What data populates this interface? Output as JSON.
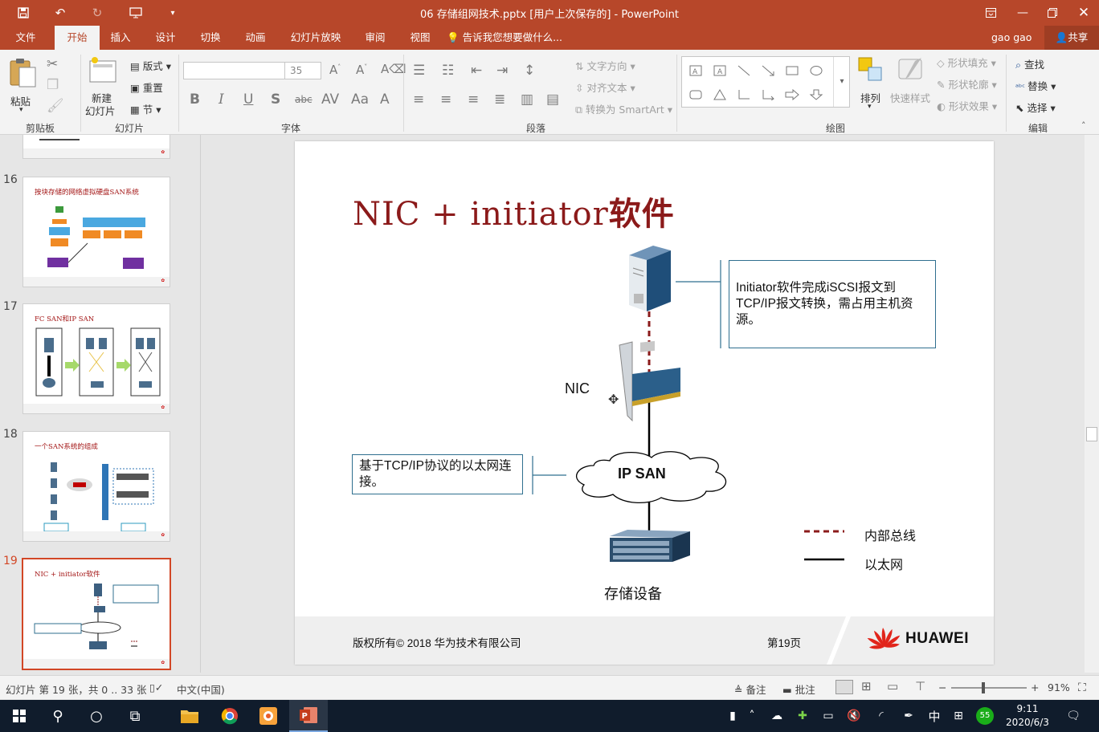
{
  "window": {
    "title": "06 存储组网技术.pptx [用户上次保存的] - PowerPoint"
  },
  "tabs": [
    "文件",
    "开始",
    "插入",
    "设计",
    "切换",
    "动画",
    "幻灯片放映",
    "审阅",
    "视图"
  ],
  "tell_me": "告诉我您想要做什么...",
  "user": "gao gao",
  "share": "共享",
  "ribbon": {
    "clipboard": {
      "paste": "粘贴",
      "label": "剪贴板"
    },
    "slides": {
      "new_slide_1": "新建",
      "new_slide_2": "幻灯片",
      "layout": "版式",
      "reset": "重置",
      "section": "节",
      "label": "幻灯片"
    },
    "font": {
      "font_value": "",
      "size_value": "35",
      "label": "字体"
    },
    "paragraph": {
      "text_direction": "文字方向",
      "align_text": "对齐文本",
      "smartart": "转换为 SmartArt",
      "label": "段落"
    },
    "drawing": {
      "arrange": "排列",
      "quick_styles": "快速样式",
      "fill": "形状填充",
      "outline": "形状轮廓",
      "effects": "形状效果",
      "label": "绘图"
    },
    "editing": {
      "find": "查找",
      "replace": "替换",
      "select": "选择",
      "label": "编辑"
    }
  },
  "thumbnails": [
    {
      "number": "16",
      "title": "按块存储的网络虚拟硬盘SAN系统"
    },
    {
      "number": "17",
      "title": "FC SAN和IP SAN"
    },
    {
      "number": "18",
      "title": "一个SAN系统的组成"
    },
    {
      "number": "19",
      "title": "NIC + initiator软件"
    }
  ],
  "slide": {
    "title_latin": "NIC + initiator",
    "title_cjk": "软件",
    "callout_top": "Initiator软件完成iSCSI报文到TCP/IP报文转换，需占用主机资源。",
    "callout_left": "基于TCP/IP协议的以太网连接。",
    "nic_label": "NIC",
    "cloud_label": "IP SAN",
    "storage_label": "存储设备",
    "legend": [
      {
        "label": "内部总线",
        "color": "#8b1a1a",
        "style": "dashed"
      },
      {
        "label": "以太网",
        "color": "#000000",
        "style": "solid"
      }
    ],
    "footer_copyright": "版权所有© 2018 华为技术有限公司",
    "footer_page": "第19页",
    "brand": "HUAWEI"
  },
  "colors": {
    "accent": "#b7472a",
    "title_red": "#8b1a1a",
    "callout_border": "#2f6f8f",
    "brand_red": "#e1251b"
  },
  "statusbar": {
    "slide_info": "幻灯片 第 19 张，共 0 .. 33 张",
    "language": "中文(中国)",
    "notes": "备注",
    "comments": "批注",
    "zoom": "91%"
  },
  "taskbar": {
    "time": "9:11",
    "date": "2020/6/3",
    "ime": "中",
    "badge": "55"
  }
}
